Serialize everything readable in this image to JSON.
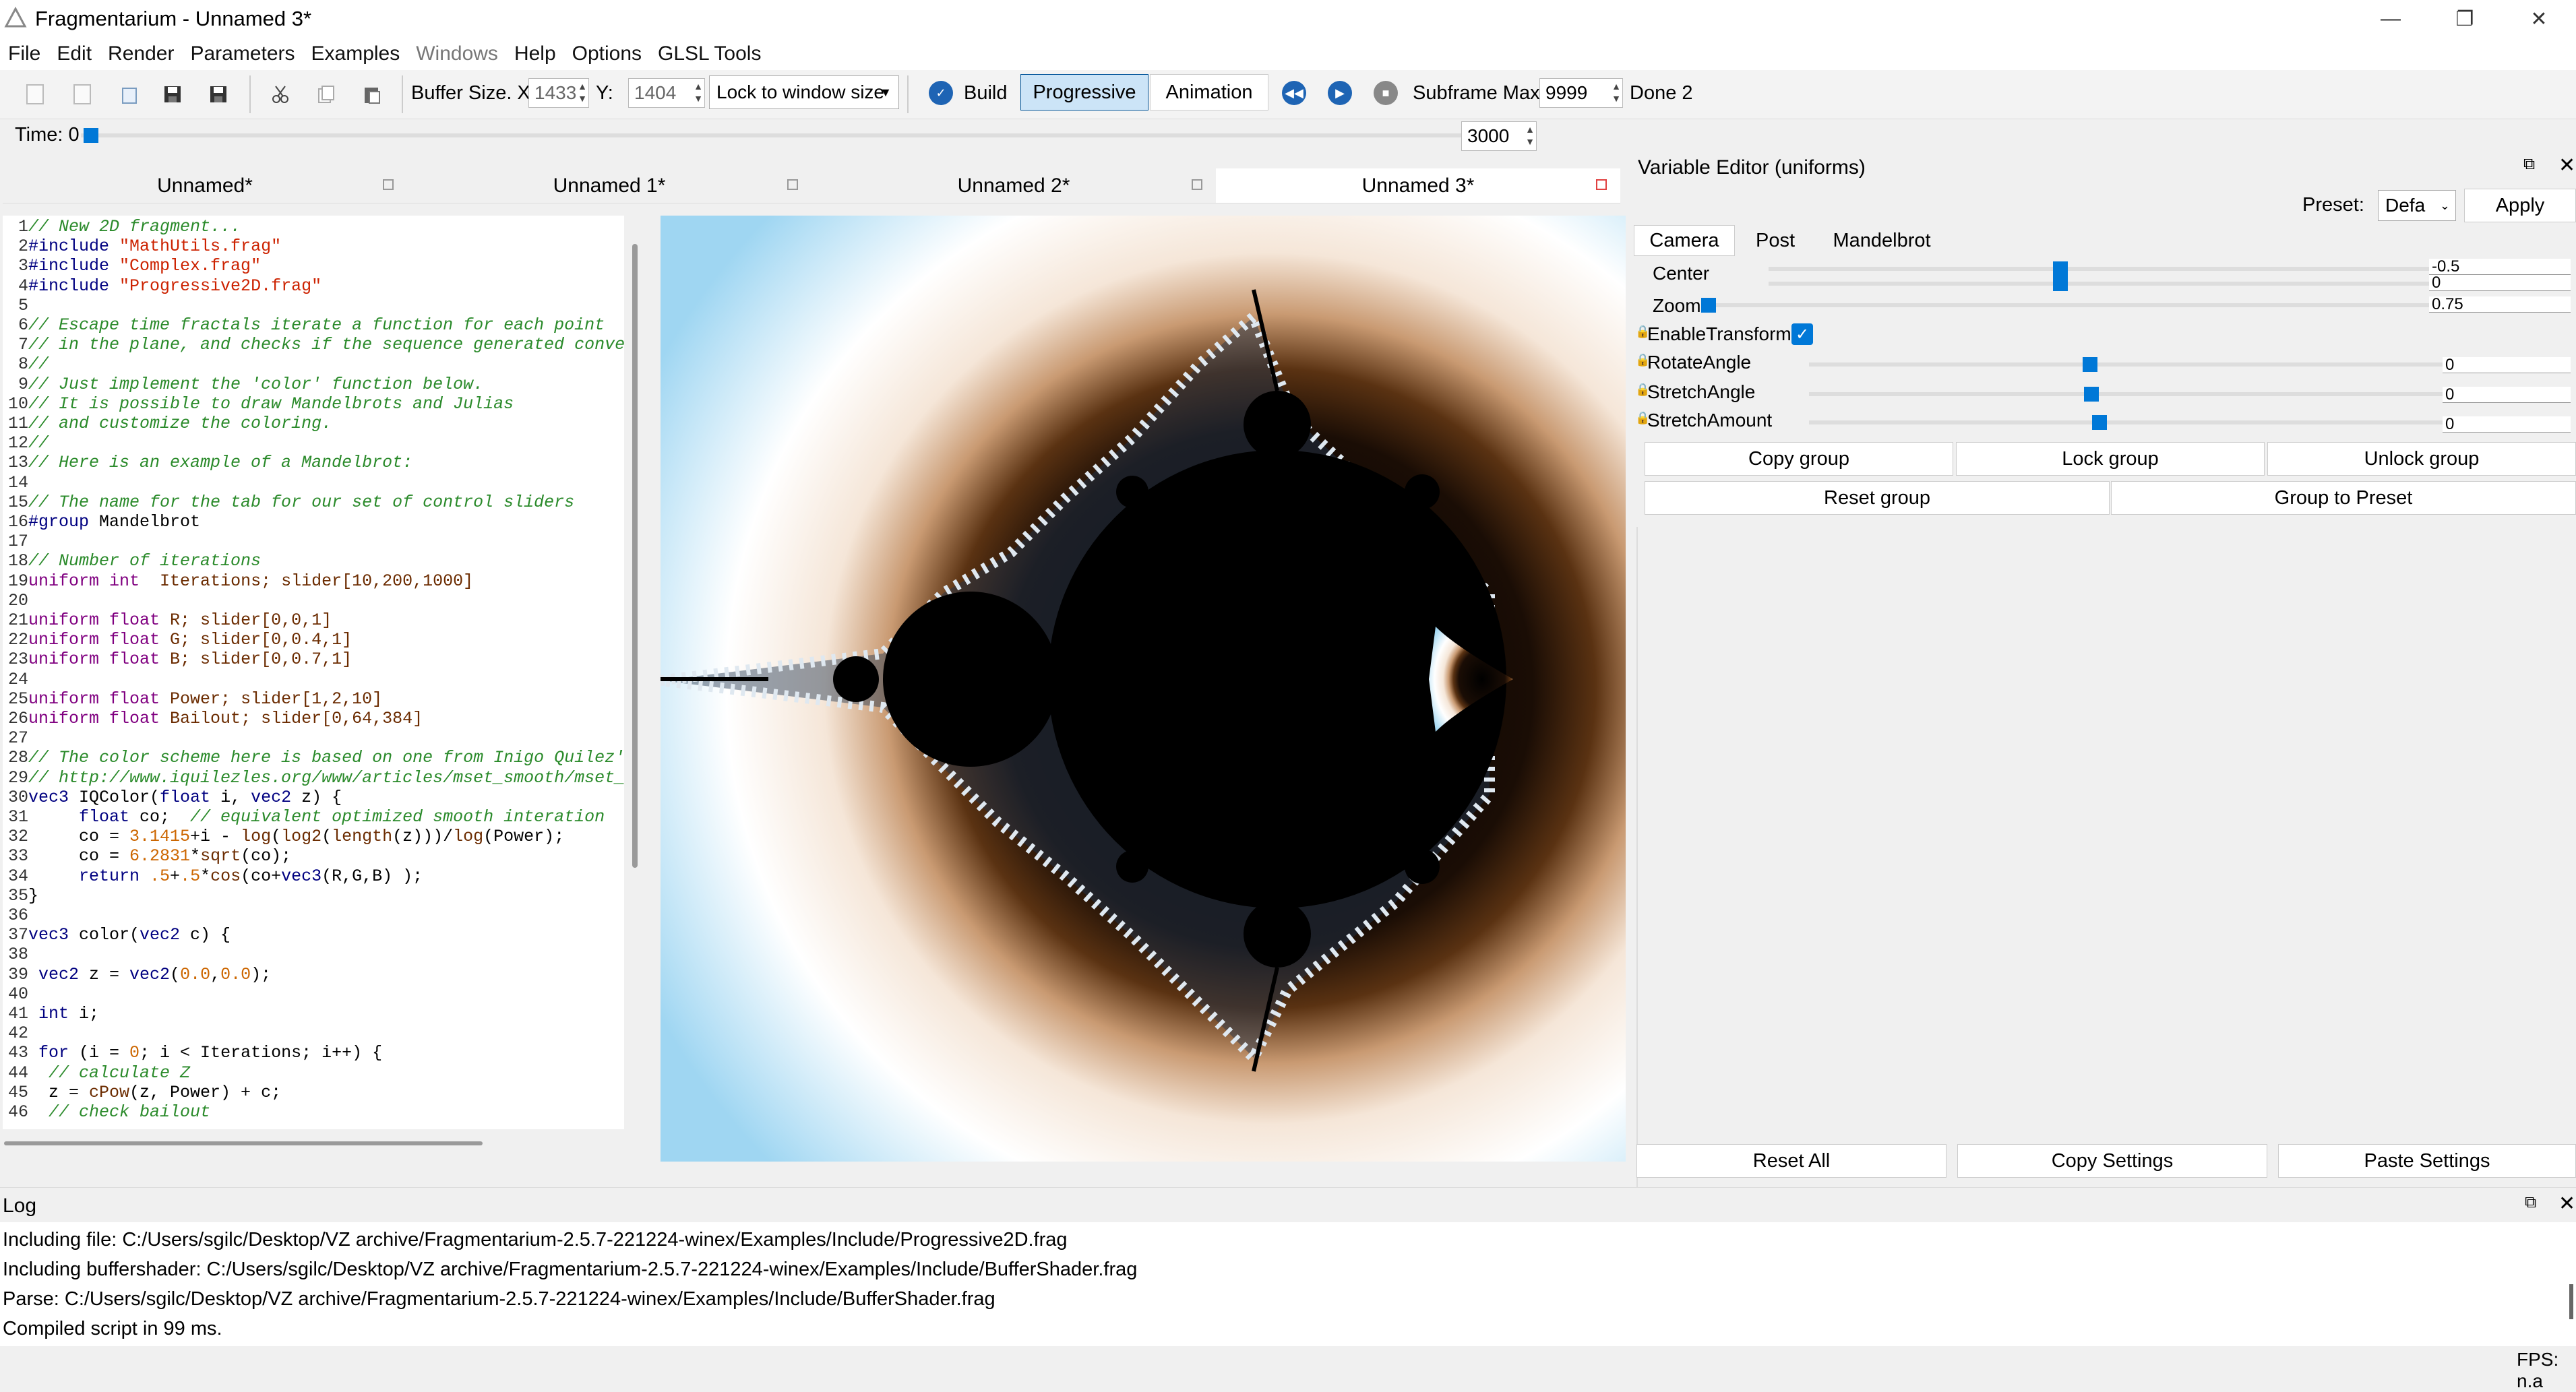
{
  "window": {
    "title": "Fragmentarium - Unnamed 3*"
  },
  "menu": [
    "File",
    "Edit",
    "Render",
    "Parameters",
    "Examples",
    "Windows",
    "Help",
    "Options",
    "GLSL Tools"
  ],
  "toolbar": {
    "buffer_size_label": "Buffer Size. X:",
    "buffer_x": "1433",
    "y_label": "Y:",
    "buffer_y": "1404",
    "lock_option": "Lock to window size",
    "build_label": "Build",
    "progressive_label": "Progressive",
    "animation_label": "Animation",
    "subframe_label": "Subframe Max:",
    "subframe_value": "9999",
    "status": "Done 2"
  },
  "time": {
    "label": "Time: 0",
    "value": "0",
    "end_value": "3000"
  },
  "tabs": [
    "Unnamed*",
    "Unnamed 1*",
    "Unnamed 2*",
    "Unnamed 3*"
  ],
  "code": [
    {
      "n": "1",
      "parts": [
        {
          "c": "comment",
          "t": "// New 2D fragment..."
        }
      ]
    },
    {
      "n": "2",
      "parts": [
        {
          "c": "pp",
          "t": "#include "
        },
        {
          "c": "str",
          "t": "\"MathUtils.frag\""
        }
      ]
    },
    {
      "n": "3",
      "parts": [
        {
          "c": "pp",
          "t": "#include "
        },
        {
          "c": "str",
          "t": "\"Complex.frag\""
        }
      ]
    },
    {
      "n": "4",
      "parts": [
        {
          "c": "pp",
          "t": "#include "
        },
        {
          "c": "str",
          "t": "\"Progressive2D.frag\""
        }
      ]
    },
    {
      "n": "5",
      "parts": []
    },
    {
      "n": "6",
      "parts": [
        {
          "c": "comment",
          "t": "// Escape time fractals iterate a function for each point"
        }
      ]
    },
    {
      "n": "7",
      "parts": [
        {
          "c": "comment",
          "t": "// in the plane, and checks if the sequence generated conve"
        }
      ]
    },
    {
      "n": "8",
      "parts": [
        {
          "c": "comment",
          "t": "//"
        }
      ]
    },
    {
      "n": "9",
      "parts": [
        {
          "c": "comment",
          "t": "// Just implement the 'color' function below."
        }
      ]
    },
    {
      "n": "10",
      "parts": [
        {
          "c": "comment",
          "t": "// It is possible to draw Mandelbrots and Julias"
        }
      ]
    },
    {
      "n": "11",
      "parts": [
        {
          "c": "comment",
          "t": "// and customize the coloring."
        }
      ]
    },
    {
      "n": "12",
      "parts": [
        {
          "c": "comment",
          "t": "//"
        }
      ]
    },
    {
      "n": "13",
      "parts": [
        {
          "c": "comment",
          "t": "// Here is an example of a Mandelbrot:"
        }
      ]
    },
    {
      "n": "14",
      "parts": []
    },
    {
      "n": "15",
      "parts": [
        {
          "c": "comment",
          "t": "// The name for the tab for our set of control sliders"
        }
      ]
    },
    {
      "n": "16",
      "parts": [
        {
          "c": "pp",
          "t": "#group "
        },
        {
          "c": "plain",
          "t": "Mandelbrot"
        }
      ]
    },
    {
      "n": "17",
      "parts": []
    },
    {
      "n": "18",
      "parts": [
        {
          "c": "comment",
          "t": "// Number of iterations"
        }
      ]
    },
    {
      "n": "19",
      "parts": [
        {
          "c": "type",
          "t": "uniform int  "
        },
        {
          "c": "fn",
          "t": "Iterations; slider[10,200,1000]"
        }
      ]
    },
    {
      "n": "20",
      "parts": []
    },
    {
      "n": "21",
      "parts": [
        {
          "c": "type",
          "t": "uniform float "
        },
        {
          "c": "fn",
          "t": "R; slider[0,0,1]"
        }
      ]
    },
    {
      "n": "22",
      "parts": [
        {
          "c": "type",
          "t": "uniform float "
        },
        {
          "c": "fn",
          "t": "G; slider[0,0.4,1]"
        }
      ]
    },
    {
      "n": "23",
      "parts": [
        {
          "c": "type",
          "t": "uniform float "
        },
        {
          "c": "fn",
          "t": "B; slider[0,0.7,1]"
        }
      ]
    },
    {
      "n": "24",
      "parts": []
    },
    {
      "n": "25",
      "parts": [
        {
          "c": "type",
          "t": "uniform float "
        },
        {
          "c": "fn",
          "t": "Power; slider[1,2,10]"
        }
      ]
    },
    {
      "n": "26",
      "parts": [
        {
          "c": "type",
          "t": "uniform float "
        },
        {
          "c": "fn",
          "t": "Bailout; slider[0,64,384]"
        }
      ]
    },
    {
      "n": "27",
      "parts": []
    },
    {
      "n": "28",
      "parts": [
        {
          "c": "comment",
          "t": "// The color scheme here is based on one from Inigo Quilez'"
        }
      ]
    },
    {
      "n": "29",
      "parts": [
        {
          "c": "comment",
          "t": "// http://www.iquilezles.org/www/articles/mset_smooth/mset_"
        }
      ]
    },
    {
      "n": "30",
      "parts": [
        {
          "c": "kw",
          "t": "vec3 "
        },
        {
          "c": "plain",
          "t": "IQColor("
        },
        {
          "c": "kw",
          "t": "float "
        },
        {
          "c": "plain",
          "t": "i, "
        },
        {
          "c": "kw",
          "t": "vec2 "
        },
        {
          "c": "plain",
          "t": "z) {"
        }
      ]
    },
    {
      "n": "31",
      "parts": [
        {
          "c": "kw",
          "t": "     float "
        },
        {
          "c": "plain",
          "t": "co;  "
        },
        {
          "c": "comment",
          "t": "// equivalent optimized smooth interation"
        }
      ]
    },
    {
      "n": "32",
      "parts": [
        {
          "c": "plain",
          "t": "     co = "
        },
        {
          "c": "num",
          "t": "3.1415"
        },
        {
          "c": "plain",
          "t": "+i - "
        },
        {
          "c": "fn",
          "t": "log"
        },
        {
          "c": "plain",
          "t": "("
        },
        {
          "c": "fn",
          "t": "log2"
        },
        {
          "c": "plain",
          "t": "("
        },
        {
          "c": "fn",
          "t": "length"
        },
        {
          "c": "plain",
          "t": "(z)))/"
        },
        {
          "c": "fn",
          "t": "log"
        },
        {
          "c": "plain",
          "t": "(Power);"
        }
      ]
    },
    {
      "n": "33",
      "parts": [
        {
          "c": "plain",
          "t": "     co = "
        },
        {
          "c": "num",
          "t": "6.2831"
        },
        {
          "c": "plain",
          "t": "*"
        },
        {
          "c": "fn",
          "t": "sqrt"
        },
        {
          "c": "plain",
          "t": "(co);"
        }
      ]
    },
    {
      "n": "34",
      "parts": [
        {
          "c": "kw",
          "t": "     return "
        },
        {
          "c": "num",
          "t": ".5"
        },
        {
          "c": "plain",
          "t": "+"
        },
        {
          "c": "num",
          "t": ".5"
        },
        {
          "c": "plain",
          "t": "*"
        },
        {
          "c": "fn",
          "t": "cos"
        },
        {
          "c": "plain",
          "t": "(co+"
        },
        {
          "c": "kw",
          "t": "vec3"
        },
        {
          "c": "plain",
          "t": "(R,G,B) );"
        }
      ]
    },
    {
      "n": "35",
      "parts": [
        {
          "c": "plain",
          "t": "}"
        }
      ]
    },
    {
      "n": "36",
      "parts": []
    },
    {
      "n": "37",
      "parts": [
        {
          "c": "kw",
          "t": "vec3 "
        },
        {
          "c": "plain",
          "t": "color("
        },
        {
          "c": "kw",
          "t": "vec2 "
        },
        {
          "c": "plain",
          "t": "c) {"
        }
      ]
    },
    {
      "n": "38",
      "parts": []
    },
    {
      "n": "39",
      "parts": [
        {
          "c": "kw",
          "t": " vec2 "
        },
        {
          "c": "plain",
          "t": "z = "
        },
        {
          "c": "kw",
          "t": "vec2"
        },
        {
          "c": "plain",
          "t": "("
        },
        {
          "c": "num",
          "t": "0.0"
        },
        {
          "c": "plain",
          "t": ","
        },
        {
          "c": "num",
          "t": "0.0"
        },
        {
          "c": "plain",
          "t": ");"
        }
      ]
    },
    {
      "n": "40",
      "parts": []
    },
    {
      "n": "41",
      "parts": [
        {
          "c": "kw",
          "t": " int "
        },
        {
          "c": "plain",
          "t": "i;"
        }
      ]
    },
    {
      "n": "42",
      "parts": []
    },
    {
      "n": "43",
      "parts": [
        {
          "c": "kw",
          "t": " for "
        },
        {
          "c": "plain",
          "t": "(i = "
        },
        {
          "c": "num",
          "t": "0"
        },
        {
          "c": "plain",
          "t": "; i < Iterations; i++) {"
        }
      ]
    },
    {
      "n": "44",
      "parts": [
        {
          "c": "comment",
          "t": "  // calculate Z"
        }
      ]
    },
    {
      "n": "45",
      "parts": [
        {
          "c": "plain",
          "t": "  z = "
        },
        {
          "c": "fn",
          "t": "cPow"
        },
        {
          "c": "plain",
          "t": "(z, Power) + c;"
        }
      ]
    },
    {
      "n": "46",
      "parts": [
        {
          "c": "comment",
          "t": "  // check bailout"
        }
      ]
    }
  ],
  "variable_editor": {
    "title": "Variable Editor (uniforms)",
    "preset_label": "Preset:",
    "preset_value": "Defa",
    "apply_label": "Apply",
    "tabs": [
      "Camera",
      "Post",
      "Mandelbrot"
    ],
    "center_label": "Center",
    "center_x": "-0.5",
    "center_y": "0",
    "zoom_label": "Zoom",
    "zoom_value": "0.75",
    "enable_transform_label": "EnableTransform",
    "rotate_label": "RotateAngle",
    "rotate_value": "0",
    "stretch_angle_label": "StretchAngle",
    "stretch_angle_value": "0",
    "stretch_amount_label": "StretchAmount",
    "stretch_amount_value": "0",
    "copy_group": "Copy group",
    "lock_group": "Lock group",
    "unlock_group": "Unlock group",
    "reset_group": "Reset group",
    "group_to_preset": "Group to Preset",
    "reset_all": "Reset All",
    "copy_settings": "Copy Settings",
    "paste_settings": "Paste Settings"
  },
  "log": {
    "title": "Log",
    "lines": [
      "Including file: C:/Users/sgilc/Desktop/VZ archive/Fragmentarium-2.5.7-221224-winex/Examples/Include/Progressive2D.frag",
      "Including buffershader: C:/Users/sgilc/Desktop/VZ archive/Fragmentarium-2.5.7-221224-winex/Examples/Include/BufferShader.frag",
      "Parse: C:/Users/sgilc/Desktop/VZ archive/Fragmentarium-2.5.7-221224-winex/Examples/Include/BufferShader.frag",
      "Compiled script in 99 ms."
    ]
  },
  "status": {
    "fps": "FPS: n.a"
  },
  "colors": {
    "accent": "#0078d7",
    "progressive_bg": "#cce4f7",
    "close_red": "#e04040"
  }
}
